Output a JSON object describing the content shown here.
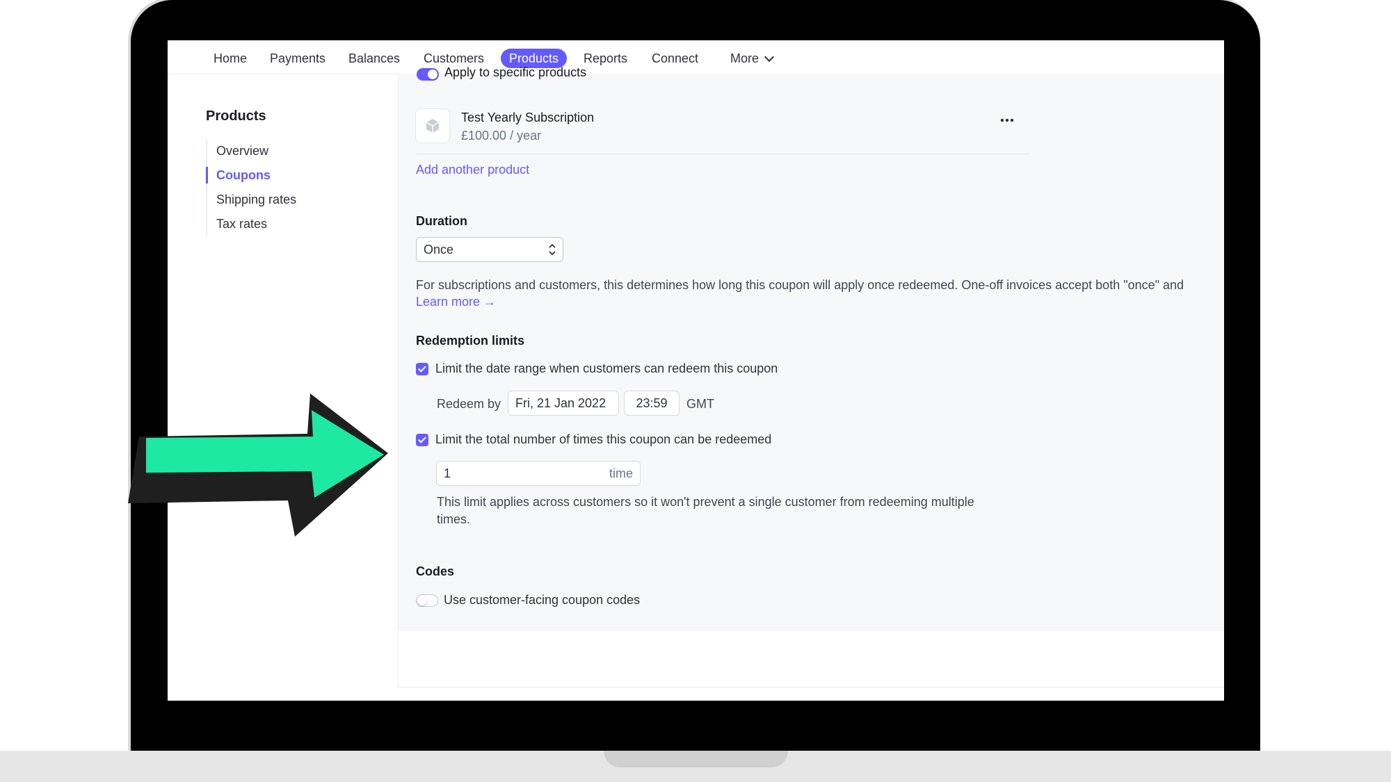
{
  "nav": {
    "items": [
      "Home",
      "Payments",
      "Balances",
      "Customers",
      "Products",
      "Reports",
      "Connect",
      "More"
    ],
    "active": "Products"
  },
  "sidebar": {
    "title": "Products",
    "items": [
      "Overview",
      "Coupons",
      "Shipping rates",
      "Tax rates"
    ],
    "active": "Coupons"
  },
  "products": {
    "toggle_label": "Apply to specific products",
    "item": {
      "name": "Test Yearly Subscription",
      "price": "£100.00 / year",
      "menu_icon": "ellipsis-icon"
    },
    "add_link": "Add another product"
  },
  "duration": {
    "label": "Duration",
    "value": "Once",
    "help": "For subscriptions and customers, this determines how long this coupon will apply once redeemed. One-off invoices accept both \"once\" and",
    "learn_more": "Learn more →"
  },
  "redemption": {
    "title": "Redemption limits",
    "date_limit_label": "Limit the date range when customers can redeem this coupon",
    "date_limit_checked": true,
    "redeem_by_label": "Redeem by",
    "date": "Fri, 21 Jan 2022",
    "time": "23:59",
    "timezone": "GMT",
    "count_limit_label": "Limit the total number of times this coupon can be redeemed",
    "count_limit_checked": true,
    "count_value": "1",
    "count_unit": "time",
    "count_help_line1": "This limit applies across customers so it won't prevent a single customer from redeeming multiple",
    "count_help_line2": "times."
  },
  "codes": {
    "title": "Codes",
    "toggle_label": "Use customer-facing coupon codes",
    "toggle_on": false
  },
  "annotation": {
    "arrow_color": "#1de9a3",
    "arrow_shadow": "#1f1f1f"
  },
  "colors": {
    "accent": "#635bff",
    "text": "#30313d",
    "muted": "#687385",
    "background": "#f6f8fa"
  }
}
